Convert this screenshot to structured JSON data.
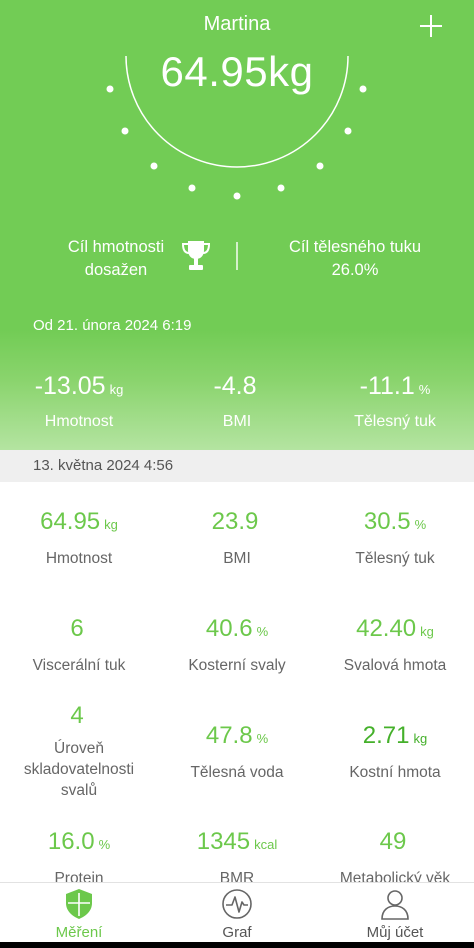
{
  "header": {
    "user_name": "Martina",
    "current_weight": "64.95kg",
    "add_icon": "plus-icon"
  },
  "goals": {
    "weight_goal_line1": "Cíl hmotnosti",
    "weight_goal_line2": "dosažen",
    "trophy_icon": "trophy-icon",
    "fat_goal_line1": "Cíl tělesného tuku",
    "fat_goal_line2": "26.0%"
  },
  "since_label": "Od 21. února 2024 6:19",
  "changes": [
    {
      "value": "-13.05",
      "unit": "kg",
      "label": "Hmotnost"
    },
    {
      "value": "-4.8",
      "unit": "",
      "label": "BMI"
    },
    {
      "value": "-11.1",
      "unit": "%",
      "label": "Tělesný tuk"
    }
  ],
  "measurement_date": "13. května 2024 4:56",
  "metrics": [
    {
      "value": "64.95",
      "unit": "kg",
      "label": "Hmotnost"
    },
    {
      "value": "23.9",
      "unit": "",
      "label": "BMI"
    },
    {
      "value": "30.5",
      "unit": "%",
      "label": "Tělesný tuk"
    },
    {
      "value": "6",
      "unit": "",
      "label": "Viscerální tuk"
    },
    {
      "value": "40.6",
      "unit": "%",
      "label": "Kosterní svaly"
    },
    {
      "value": "42.40",
      "unit": "kg",
      "label": "Svalová hmota"
    },
    {
      "value": "4",
      "unit": "",
      "label": "Úroveň skladovatelnosti svalů"
    },
    {
      "value": "47.8",
      "unit": "%",
      "label": "Tělesná voda"
    },
    {
      "value": "2.71",
      "unit": "kg",
      "label": "Kostní hmota"
    },
    {
      "value": "16.0",
      "unit": "%",
      "label": "Protein"
    },
    {
      "value": "1345",
      "unit": "kcal",
      "label": "BMR"
    },
    {
      "value": "49",
      "unit": "",
      "label": "Metabolický věk"
    }
  ],
  "nav": [
    {
      "label": "Měření",
      "icon": "shield-icon",
      "active": true
    },
    {
      "label": "Graf",
      "icon": "pulse-icon",
      "active": false
    },
    {
      "label": "Můj účet",
      "icon": "person-icon",
      "active": false
    }
  ],
  "colors": {
    "brand_green": "#72cc55",
    "metric_green": "#6cc84b",
    "label_gray": "#666666"
  }
}
